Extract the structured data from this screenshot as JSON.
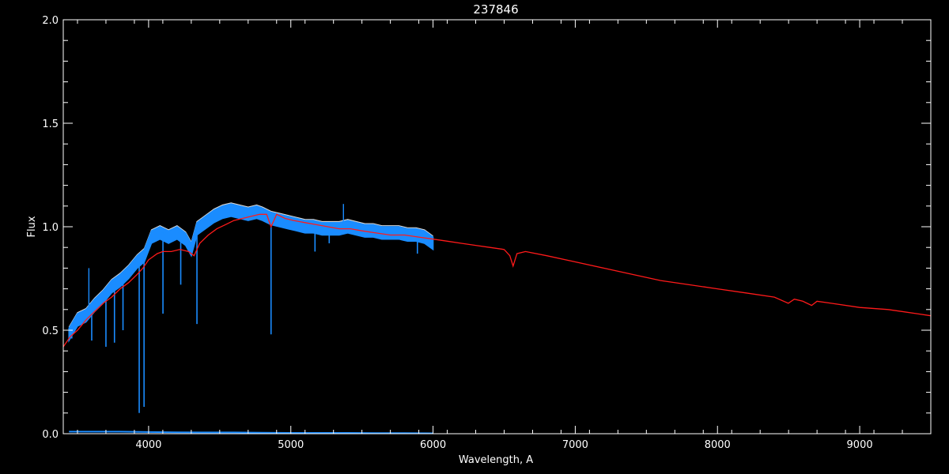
{
  "chart_data": {
    "type": "line",
    "title": "237846",
    "xlabel": "Wavelength, A",
    "ylabel": "Flux",
    "xlim": [
      3400,
      9500
    ],
    "ylim": [
      0.0,
      2.0
    ],
    "x_ticks": [
      4000,
      5000,
      6000,
      7000,
      8000,
      9000
    ],
    "x_tick_labels": [
      "4000",
      "5000",
      "6000",
      "7000",
      "8000",
      "9000"
    ],
    "y_ticks": [
      0.0,
      0.5,
      1.0,
      1.5,
      2.0
    ],
    "y_tick_labels": [
      "0.0",
      "0.5",
      "1.0",
      "1.5",
      "2.0"
    ],
    "grid": false,
    "colors": {
      "background": "#000000",
      "axes": "#ffffff",
      "observed": "#1a8cff",
      "observed_upper": "#ffffff",
      "model": "#ff1a1a",
      "error": "#1a8cff"
    },
    "series": [
      {
        "x": [
          3440,
          3500,
          3560,
          3620,
          3680,
          3740,
          3800,
          3860,
          3920,
          3970,
          4020,
          4080,
          4140,
          4200,
          4260,
          4300,
          4340,
          4400,
          4460,
          4520,
          4580,
          4640,
          4700,
          4760,
          4800,
          4860,
          4920,
          4980,
          5040,
          5100,
          5160,
          5220,
          5280,
          5340,
          5400,
          5460,
          5520,
          5580,
          5640,
          5700,
          5760,
          5820,
          5880,
          5940,
          6000
        ],
        "y": [
          0.49,
          0.56,
          0.58,
          0.63,
          0.67,
          0.72,
          0.75,
          0.79,
          0.84,
          0.87,
          0.96,
          0.98,
          0.96,
          0.98,
          0.95,
          0.9,
          1.0,
          1.03,
          1.06,
          1.08,
          1.09,
          1.08,
          1.07,
          1.08,
          1.07,
          1.05,
          1.04,
          1.03,
          1.02,
          1.01,
          1.01,
          1.0,
          1.0,
          1.0,
          1.01,
          1.0,
          0.99,
          0.99,
          0.98,
          0.98,
          0.98,
          0.97,
          0.97,
          0.96,
          0.93
        ]
      },
      {
        "x": [
          3400,
          3450,
          3500,
          3560,
          3620,
          3680,
          3740,
          3800,
          3860,
          3920,
          3960,
          4000,
          4060,
          4100,
          4160,
          4220,
          4280,
          4320,
          4360,
          4420,
          4480,
          4540,
          4600,
          4660,
          4720,
          4780,
          4830,
          4861,
          4900,
          4960,
          5020,
          5100,
          5180,
          5260,
          5340,
          5420,
          5500,
          5600,
          5700,
          5800,
          5900,
          6000,
          6100,
          6200,
          6300,
          6400,
          6500,
          6540,
          6563,
          6590,
          6650,
          6800,
          7000,
          7200,
          7400,
          7600,
          7800,
          8000,
          8200,
          8400,
          8498,
          8540,
          8600,
          8662,
          8700,
          8800,
          9000,
          9200,
          9400,
          9500
        ],
        "y": [
          0.42,
          0.47,
          0.5,
          0.55,
          0.59,
          0.63,
          0.66,
          0.7,
          0.73,
          0.77,
          0.8,
          0.84,
          0.87,
          0.88,
          0.88,
          0.89,
          0.88,
          0.86,
          0.92,
          0.96,
          0.99,
          1.01,
          1.03,
          1.04,
          1.05,
          1.06,
          1.06,
          1.0,
          1.06,
          1.04,
          1.03,
          1.02,
          1.01,
          1.0,
          0.99,
          0.99,
          0.98,
          0.97,
          0.96,
          0.96,
          0.95,
          0.94,
          0.93,
          0.92,
          0.91,
          0.9,
          0.89,
          0.86,
          0.81,
          0.87,
          0.88,
          0.86,
          0.83,
          0.8,
          0.77,
          0.74,
          0.72,
          0.7,
          0.68,
          0.66,
          0.63,
          0.65,
          0.64,
          0.62,
          0.64,
          0.63,
          0.61,
          0.6,
          0.58,
          0.57
        ]
      },
      {
        "x": [
          3440,
          3600,
          3800,
          4000,
          4200,
          4400,
          4600,
          4800,
          5000,
          5200,
          5400,
          5600,
          5800,
          6000
        ],
        "y": [
          0.01,
          0.01,
          0.01,
          0.008,
          0.007,
          0.006,
          0.006,
          0.005,
          0.004,
          0.004,
          0.004,
          0.003,
          0.003,
          0.002
        ]
      }
    ]
  }
}
